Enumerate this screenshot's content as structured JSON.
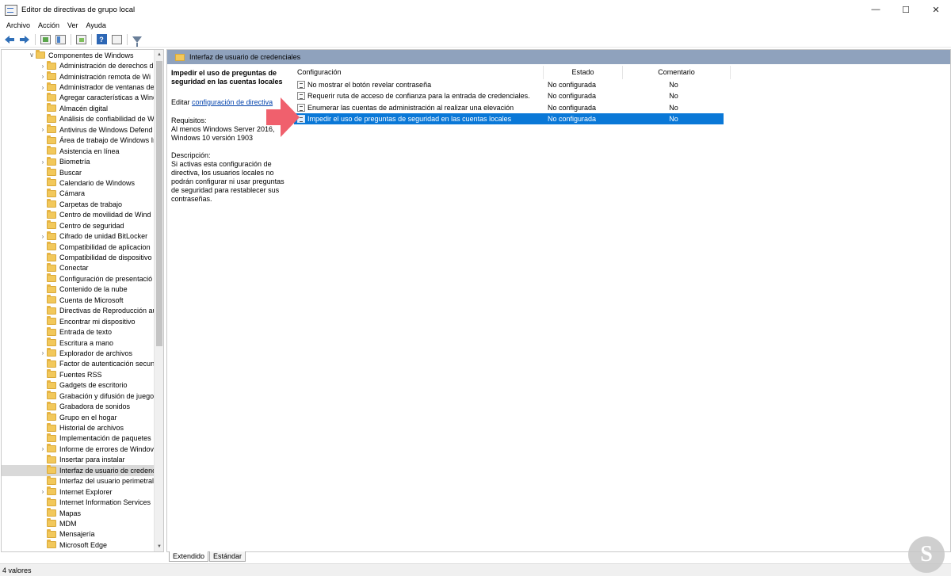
{
  "window": {
    "title": "Editor de directivas de grupo local",
    "minimize": "—",
    "maximize": "☐",
    "close": "✕"
  },
  "menu": [
    "Archivo",
    "Acción",
    "Ver",
    "Ayuda"
  ],
  "tree": {
    "root_label": "Componentes de Windows",
    "items": [
      {
        "label": "Administración de derechos d",
        "expandable": true
      },
      {
        "label": "Administración remota de Wi",
        "expandable": true
      },
      {
        "label": "Administrador de ventanas de",
        "expandable": true
      },
      {
        "label": "Agregar características a Wind",
        "expandable": false
      },
      {
        "label": "Almacén digital",
        "expandable": false
      },
      {
        "label": "Análisis de confiabilidad de W",
        "expandable": false
      },
      {
        "label": "Antivirus de Windows Defend",
        "expandable": true
      },
      {
        "label": "Área de trabajo de Windows Ir",
        "expandable": false
      },
      {
        "label": "Asistencia en línea",
        "expandable": false
      },
      {
        "label": "Biometría",
        "expandable": true
      },
      {
        "label": "Buscar",
        "expandable": false
      },
      {
        "label": "Calendario de Windows",
        "expandable": false
      },
      {
        "label": "Cámara",
        "expandable": false
      },
      {
        "label": "Carpetas de trabajo",
        "expandable": false
      },
      {
        "label": "Centro de movilidad de Wind",
        "expandable": false
      },
      {
        "label": "Centro de seguridad",
        "expandable": false
      },
      {
        "label": "Cifrado de unidad BitLocker",
        "expandable": true
      },
      {
        "label": "Compatibilidad de aplicacion",
        "expandable": false
      },
      {
        "label": "Compatibilidad de dispositivo",
        "expandable": false
      },
      {
        "label": "Conectar",
        "expandable": false
      },
      {
        "label": "Configuración de presentació",
        "expandable": false
      },
      {
        "label": "Contenido de la nube",
        "expandable": false
      },
      {
        "label": "Cuenta de Microsoft",
        "expandable": false
      },
      {
        "label": "Directivas de Reproducción au",
        "expandable": false
      },
      {
        "label": "Encontrar mi dispositivo",
        "expandable": false
      },
      {
        "label": "Entrada de texto",
        "expandable": false
      },
      {
        "label": "Escritura a mano",
        "expandable": false
      },
      {
        "label": "Explorador de archivos",
        "expandable": true
      },
      {
        "label": "Factor de autenticación secun",
        "expandable": false
      },
      {
        "label": "Fuentes RSS",
        "expandable": false
      },
      {
        "label": "Gadgets de escritorio",
        "expandable": false
      },
      {
        "label": "Grabación y difusión de juego",
        "expandable": false
      },
      {
        "label": "Grabadora de sonidos",
        "expandable": false
      },
      {
        "label": "Grupo en el hogar",
        "expandable": false
      },
      {
        "label": "Historial de archivos",
        "expandable": false
      },
      {
        "label": "Implementación de paquetes",
        "expandable": false
      },
      {
        "label": "Informe de errores de Windov",
        "expandable": true
      },
      {
        "label": "Insertar para instalar",
        "expandable": false
      },
      {
        "label": "Interfaz de usuario de credenc",
        "expandable": false,
        "selected": true
      },
      {
        "label": "Interfaz del usuario perimetral",
        "expandable": false
      },
      {
        "label": "Internet Explorer",
        "expandable": true
      },
      {
        "label": "Internet Information Services",
        "expandable": false
      },
      {
        "label": "Mapas",
        "expandable": false
      },
      {
        "label": "MDM",
        "expandable": false
      },
      {
        "label": "Mensajería",
        "expandable": false
      },
      {
        "label": "Microsoft Edge",
        "expandable": false
      }
    ]
  },
  "right": {
    "header": "Interfaz de usuario de credenciales",
    "description": {
      "title": "Impedir el uso de preguntas de seguridad en las cuentas locales",
      "edit_prefix": "Editar",
      "edit_link": "configuración de directiva",
      "requirements_label": "Requisitos:",
      "requirements_text": "Al menos Windows Server 2016, Windows 10 versión 1903",
      "description_label": "Descripción:",
      "description_text": "Si activas esta configuración de directiva, los usuarios locales no podrán configurar ni usar preguntas de seguridad para restablecer sus contraseñas."
    },
    "columns": [
      "Configuración",
      "Estado",
      "Comentario"
    ],
    "rows": [
      {
        "name": "No mostrar el botón revelar contraseña",
        "state": "No configurada",
        "comment": "No"
      },
      {
        "name": "Requerir ruta de acceso de confianza para la entrada de credenciales.",
        "state": "No configurada",
        "comment": "No"
      },
      {
        "name": "Enumerar las cuentas de administración al realizar una elevación",
        "state": "No configurada",
        "comment": "No"
      },
      {
        "name": "Impedir el uso de preguntas de seguridad en las cuentas locales",
        "state": "No configurada",
        "comment": "No",
        "selected": true
      }
    ]
  },
  "tabs": [
    "Extendido",
    "Estándar"
  ],
  "status": "4 valores",
  "colors": {
    "header_bar": "#8fa2bd",
    "selection": "#0a78d7",
    "annotation_arrow": "#f0606d",
    "folder": "#f2c85b"
  }
}
